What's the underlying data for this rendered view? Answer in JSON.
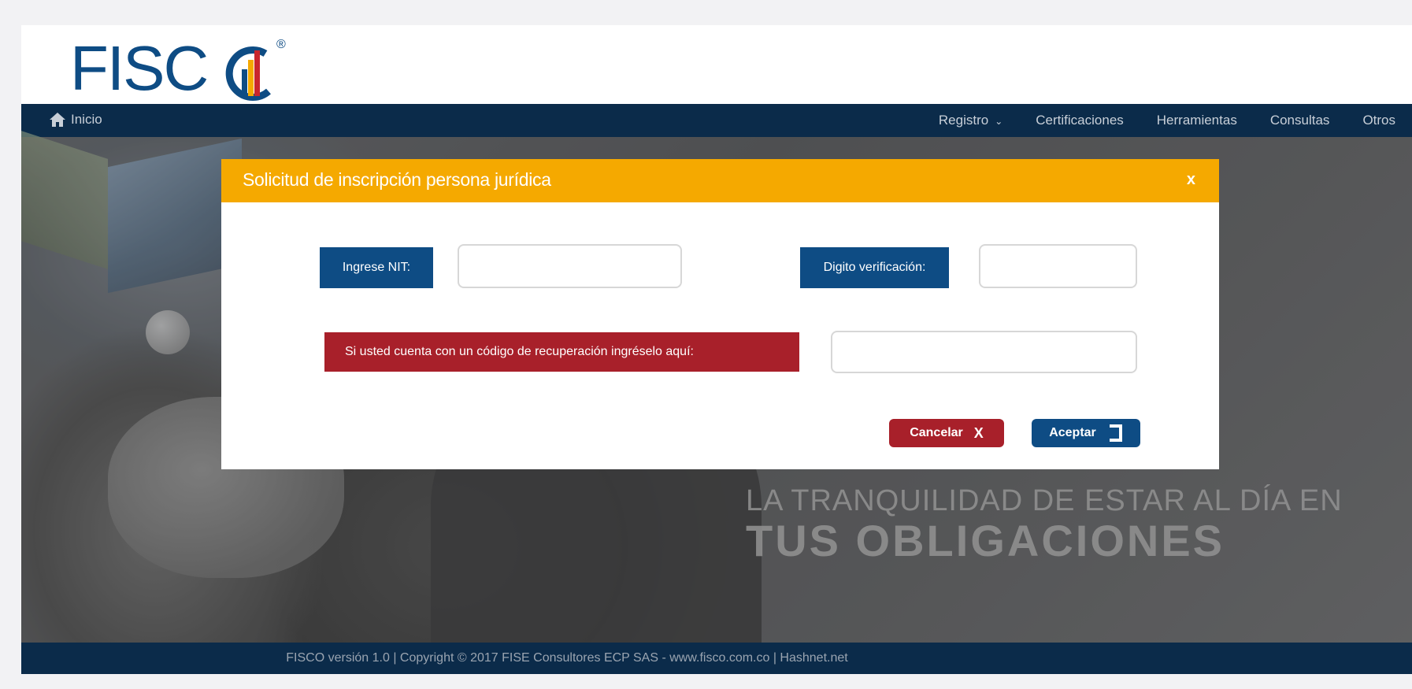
{
  "brand": {
    "logo_text": "FISC",
    "registered_mark": "®"
  },
  "nav": {
    "home_label": "Inicio",
    "items": [
      {
        "label": "Registro",
        "has_dropdown": true
      },
      {
        "label": "Certificaciones"
      },
      {
        "label": "Herramientas"
      },
      {
        "label": "Consultas"
      },
      {
        "label": "Otros"
      }
    ]
  },
  "hero": {
    "tagline_line1": "LA TRANQUILIDAD DE ESTAR AL DÍA EN",
    "tagline_line2": "TUS OBLIGACIONES"
  },
  "modal": {
    "title": "Solicitud de inscripción persona jurídica",
    "close_label": "x",
    "nit_label": "Ingrese NIT:",
    "nit_value": "",
    "digit_label": "Digito verificación:",
    "digit_value": "",
    "recovery_label": "Si usted cuenta con un código de recuperación ingréselo aquí:",
    "recovery_value": "",
    "cancel_label": "Cancelar",
    "cancel_icon": "X",
    "accept_label": "Aceptar"
  },
  "footer": {
    "text": "FISCO versión 1.0 | Copyright © 2017 FISE Consultores ECP SAS - www.fisco.com.co | Hashnet.net"
  },
  "colors": {
    "navy": "#0b2b4a",
    "brand_blue": "#0e4c84",
    "modal_header": "#f5a900",
    "danger_red": "#a8202a"
  }
}
